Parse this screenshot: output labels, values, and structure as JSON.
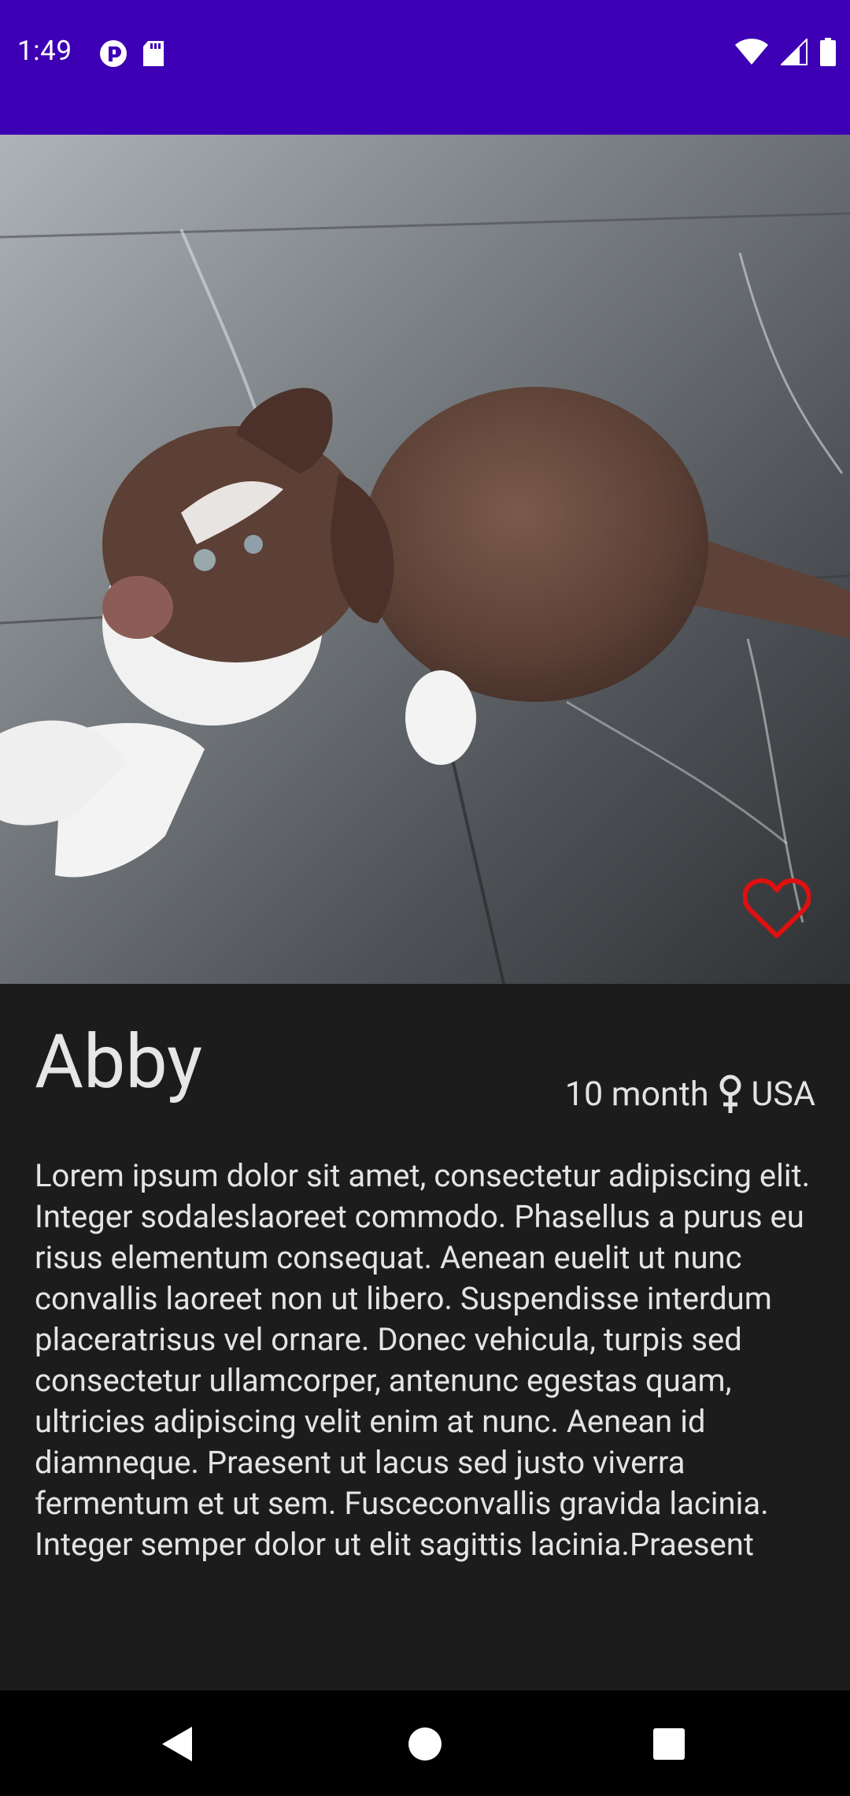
{
  "status_bar": {
    "time": "1:49",
    "left_icons": [
      "pocket-casts-icon",
      "sd-card-icon"
    ],
    "right_icons": [
      "wifi-icon",
      "cell-signal-icon",
      "battery-icon"
    ]
  },
  "pet": {
    "name": "Abby",
    "age": "10 month",
    "gender_icon": "female-icon",
    "location": "USA",
    "description": "Lorem ipsum dolor sit amet, consectetur adipiscing elit. Integer sodaleslaoreet commodo. Phasellus a purus eu risus elementum consequat. Aenean euelit ut nunc convallis laoreet non ut libero. Suspendisse interdum placeratrisus vel ornare. Donec vehicula, turpis sed consectetur ullamcorper, antenunc egestas quam, ultricies adipiscing velit enim at nunc. Aenean id diamneque. Praesent ut lacus sed justo viverra fermentum et ut sem. Fusceconvallis gravida lacinia. Integer semper dolor ut elit sagittis lacinia.Praesent",
    "favorite_icon": "heart-outline-icon",
    "photo": "puppy-photo"
  },
  "colors": {
    "status_bar": "#3e00b5",
    "background": "#1c1c1c",
    "favorite": "#e01010"
  },
  "nav_bar": {
    "buttons": [
      "back-icon",
      "home-icon",
      "recents-icon"
    ]
  }
}
